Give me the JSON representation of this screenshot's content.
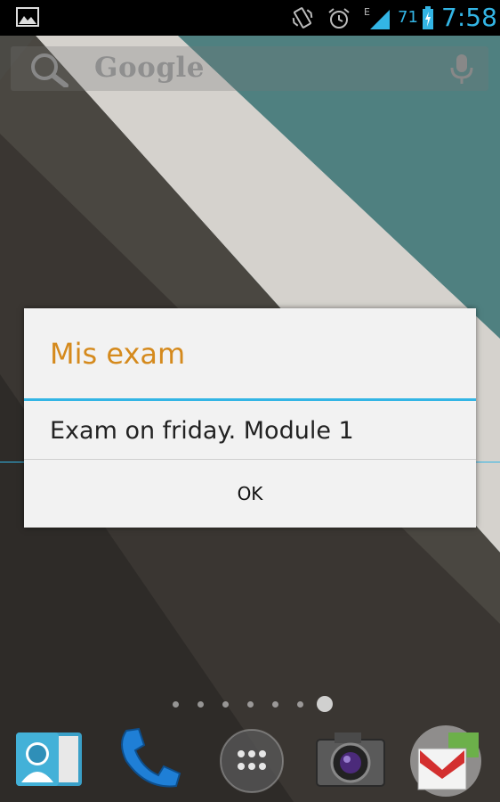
{
  "status_bar": {
    "network_type": "E",
    "battery_percent": "71",
    "time": "7:58",
    "icons": [
      "gallery-notification-icon",
      "vibrate-icon",
      "alarm-icon",
      "signal-icon",
      "battery-icon"
    ]
  },
  "search_bar": {
    "brand": "Google",
    "icons": [
      "search-icon",
      "mic-icon"
    ]
  },
  "dialog": {
    "title": "Mis exam",
    "message": "Exam on friday. Module 1",
    "ok_label": "OK"
  },
  "home": {
    "page_count": 7,
    "active_page": 7,
    "dock": [
      "contacts-icon",
      "phone-icon",
      "all-apps-icon",
      "camera-icon",
      "gmail-icon"
    ]
  },
  "colors": {
    "accent": "#33b5e5",
    "dialog_title": "#d58a1d",
    "dialog_bg": "#f2f2f2"
  }
}
